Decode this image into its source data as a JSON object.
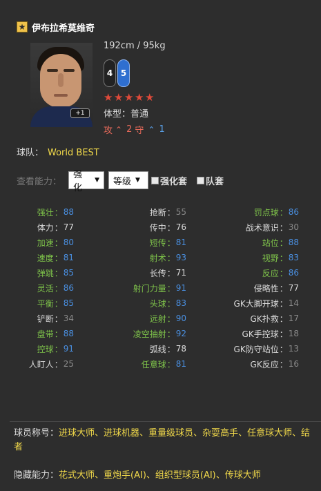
{
  "player": {
    "name": "伊布拉希莫维奇",
    "height_weight": "192cm / 95kg",
    "plus_badge": "+1",
    "left_foot": "4",
    "right_foot": "5",
    "stars": 5,
    "body_type_label": "体型：",
    "body_type_value": "普通",
    "attack_label": "攻",
    "attack_value": "2",
    "defense_label": "守",
    "defense_value": "1"
  },
  "team": {
    "label": "球队：",
    "value": "World BEST"
  },
  "controls": {
    "view_label": "查看能力：",
    "select1": "强化",
    "select2": "等级",
    "checkbox1": "强化套",
    "checkbox2": "队套"
  },
  "stats": [
    [
      {
        "label": "强壮",
        "value": "88",
        "lc": "green",
        "vc": "blue"
      },
      {
        "label": "抢断",
        "value": "55",
        "lc": "white",
        "vc": "gray"
      },
      {
        "label": "罚点球",
        "value": "86",
        "lc": "green",
        "vc": "blue"
      }
    ],
    [
      {
        "label": "体力",
        "value": "77",
        "lc": "white",
        "vc": "white"
      },
      {
        "label": "传中",
        "value": "76",
        "lc": "white",
        "vc": "white"
      },
      {
        "label": "战术意识",
        "value": "30",
        "lc": "white",
        "vc": "gray"
      }
    ],
    [
      {
        "label": "加速",
        "value": "80",
        "lc": "green",
        "vc": "blue"
      },
      {
        "label": "短传",
        "value": "81",
        "lc": "green",
        "vc": "blue"
      },
      {
        "label": "站位",
        "value": "88",
        "lc": "green",
        "vc": "blue"
      }
    ],
    [
      {
        "label": "速度",
        "value": "81",
        "lc": "green",
        "vc": "blue"
      },
      {
        "label": "射术",
        "value": "93",
        "lc": "green",
        "vc": "blue"
      },
      {
        "label": "视野",
        "value": "83",
        "lc": "green",
        "vc": "blue"
      }
    ],
    [
      {
        "label": "弹跳",
        "value": "85",
        "lc": "green",
        "vc": "blue"
      },
      {
        "label": "长传",
        "value": "71",
        "lc": "white",
        "vc": "white"
      },
      {
        "label": "反应",
        "value": "86",
        "lc": "green",
        "vc": "blue"
      }
    ],
    [
      {
        "label": "灵活",
        "value": "86",
        "lc": "green",
        "vc": "blue"
      },
      {
        "label": "射门力量",
        "value": "91",
        "lc": "green",
        "vc": "blue"
      },
      {
        "label": "侵略性",
        "value": "77",
        "lc": "white",
        "vc": "white"
      }
    ],
    [
      {
        "label": "平衡",
        "value": "85",
        "lc": "green",
        "vc": "blue"
      },
      {
        "label": "头球",
        "value": "83",
        "lc": "green",
        "vc": "blue"
      },
      {
        "label": "GK大脚开球",
        "value": "14",
        "lc": "white",
        "vc": "gray"
      }
    ],
    [
      {
        "label": "铲断",
        "value": "34",
        "lc": "white",
        "vc": "gray"
      },
      {
        "label": "远射",
        "value": "90",
        "lc": "green",
        "vc": "blue"
      },
      {
        "label": "GK扑救",
        "value": "17",
        "lc": "white",
        "vc": "gray"
      }
    ],
    [
      {
        "label": "盘带",
        "value": "88",
        "lc": "green",
        "vc": "blue"
      },
      {
        "label": "凌空抽射",
        "value": "92",
        "lc": "green",
        "vc": "blue"
      },
      {
        "label": "GK手控球",
        "value": "18",
        "lc": "white",
        "vc": "gray"
      }
    ],
    [
      {
        "label": "控球",
        "value": "91",
        "lc": "green",
        "vc": "blue"
      },
      {
        "label": "弧线",
        "value": "78",
        "lc": "white",
        "vc": "white"
      },
      {
        "label": "GK防守站位",
        "value": "13",
        "lc": "white",
        "vc": "gray"
      }
    ],
    [
      {
        "label": "人盯人",
        "value": "25",
        "lc": "white",
        "vc": "gray"
      },
      {
        "label": "任意球",
        "value": "81",
        "lc": "green",
        "vc": "blue"
      },
      {
        "label": "GK反应",
        "value": "16",
        "lc": "white",
        "vc": "gray"
      }
    ]
  ],
  "titles": {
    "label": "球员称号：",
    "value": "进球大师、进球机器、重量级球员、杂耍高手、任意球大师、结者"
  },
  "hidden": {
    "label": "隐藏能力：",
    "value": "花式大师、重炮手(AI)、组织型球员(AI)、传球大师"
  },
  "colors": {
    "green": "#7ec24a",
    "blue": "#4a90e2",
    "yellow": "#f0d84a",
    "red": "#e86a5a"
  }
}
